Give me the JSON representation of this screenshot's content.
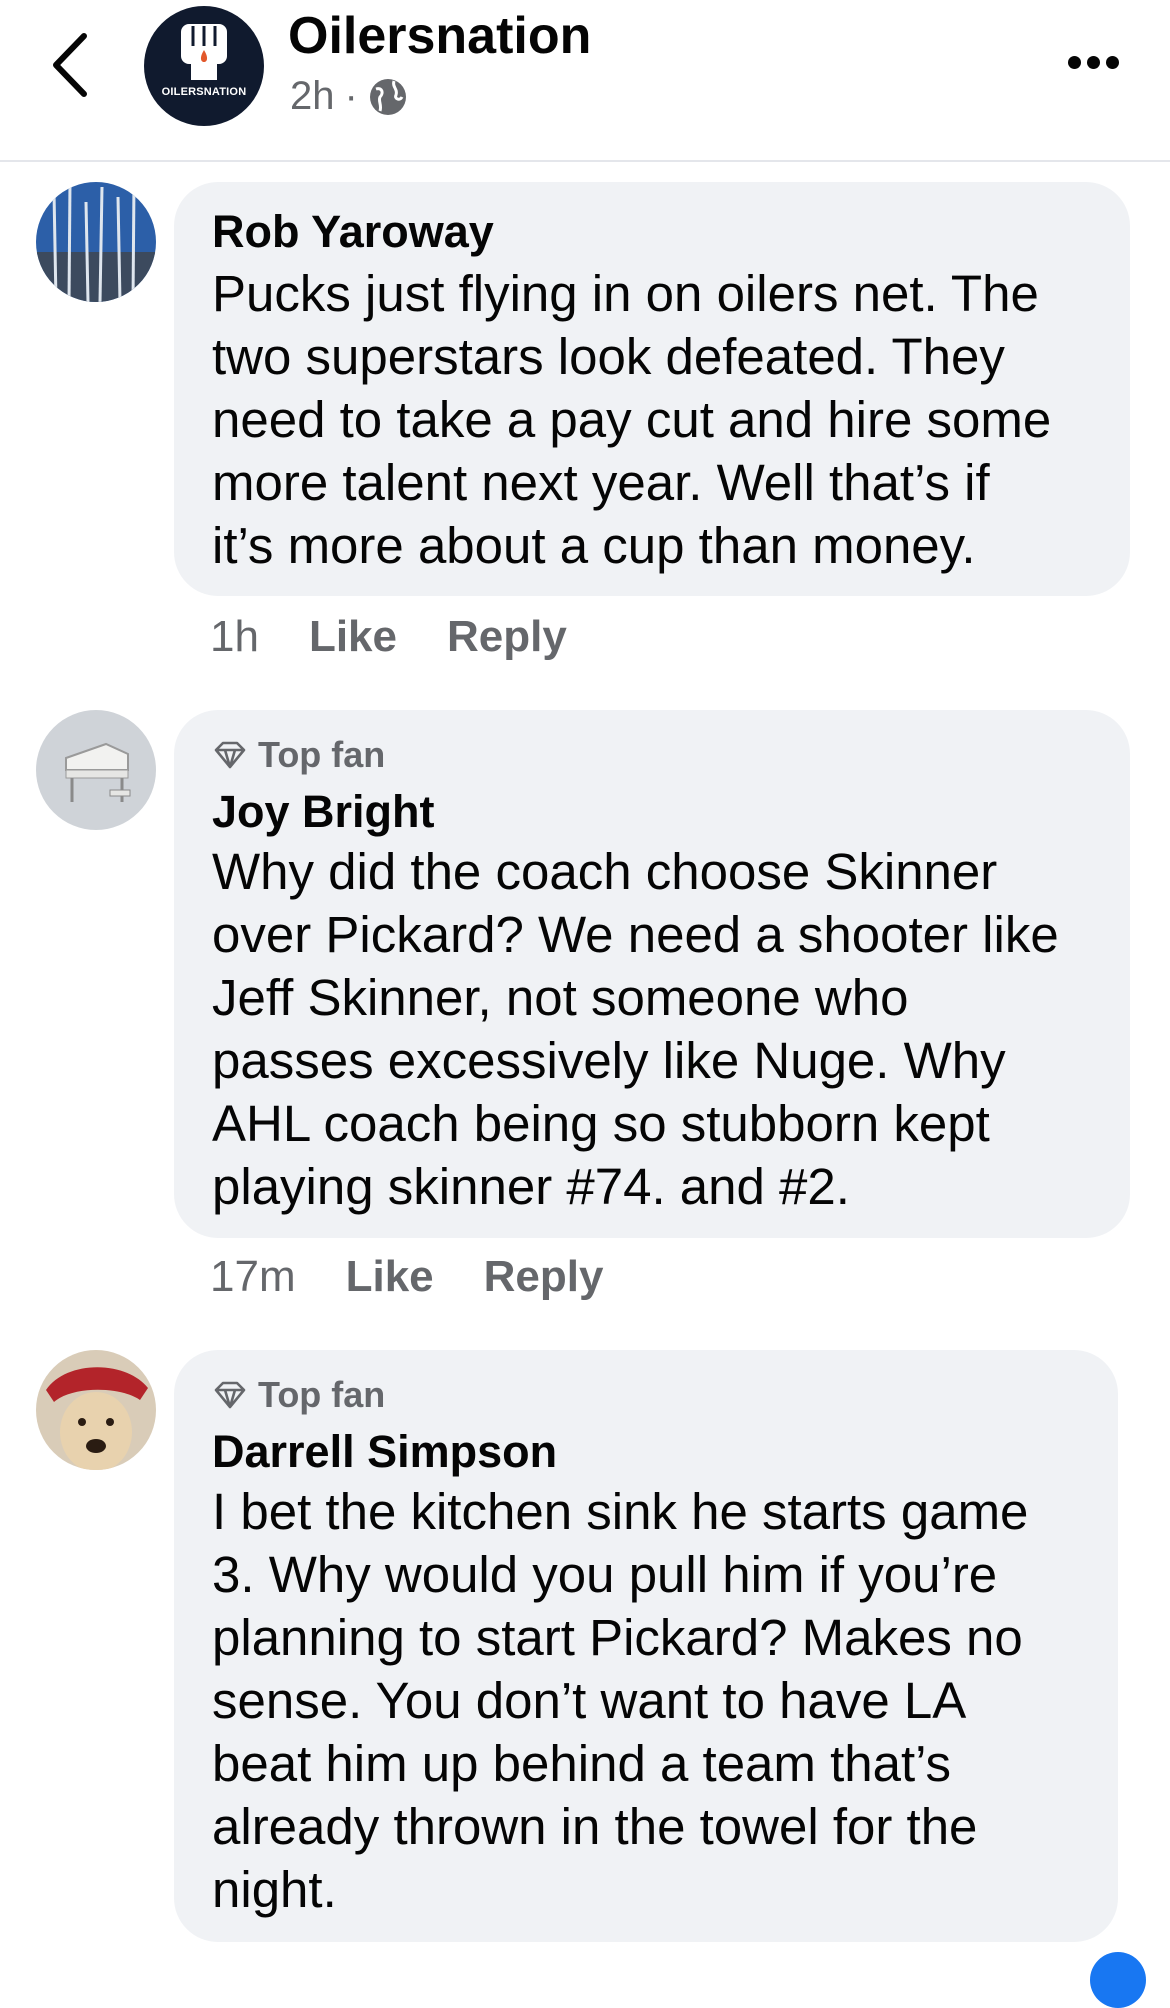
{
  "header": {
    "page_name": "Oilersnation",
    "time": "2h",
    "separator": "·",
    "avatar_text": "OILERSNATION"
  },
  "comments": [
    {
      "author": "Rob Yaroway",
      "badge": "",
      "lines": [
        "Pucks just flying in on oilers net. The",
        "two superstars look defeated. They",
        "need to take a pay cut and hire some",
        "more talent next year. Well that’s if",
        "it’s more about a cup than money."
      ],
      "time": "1h",
      "like": "Like",
      "reply": "Reply"
    },
    {
      "author": "Joy Bright",
      "badge": "Top fan",
      "lines": [
        "Why did the coach choose Skinner",
        "over Pickard? We need a shooter like",
        "Jeff Skinner, not someone who",
        "passes excessively like Nuge. Why",
        "AHL coach being so stubborn kept",
        "playing skinner #74. and #2."
      ],
      "time": "17m",
      "like": "Like",
      "reply": "Reply"
    },
    {
      "author": "Darrell Simpson",
      "badge": "Top fan",
      "lines": [
        "I bet the kitchen sink he starts game",
        "3. Why would you pull him if you’re",
        "planning to start Pickard? Makes no",
        "sense. You don’t want to have LA",
        "beat him up behind a team that’s",
        "already thrown in the towel for the",
        "night."
      ]
    }
  ],
  "colors": {
    "bubble": "#f0f2f5",
    "secondary_text": "#65676b",
    "accent": "#1877f2"
  },
  "icons": [
    "back-chevron-icon",
    "globe-icon",
    "more-options-icon",
    "diamond-icon"
  ]
}
